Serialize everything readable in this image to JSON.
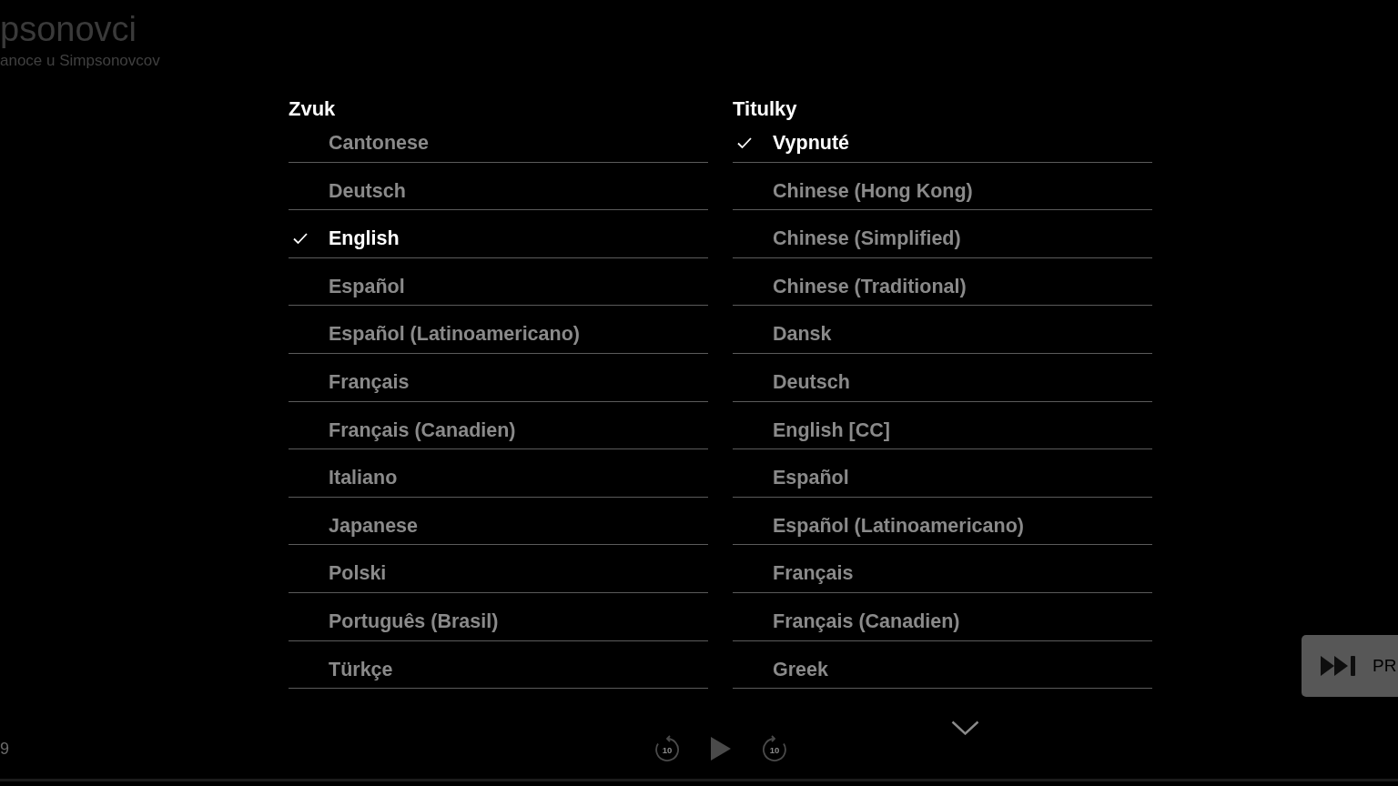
{
  "show": {
    "title": "psonovci",
    "episode": "anoce u Simpsonovcov"
  },
  "audio": {
    "heading": "Zvuk",
    "options": [
      {
        "label": "Cantonese",
        "selected": false
      },
      {
        "label": "Deutsch",
        "selected": false
      },
      {
        "label": "English",
        "selected": true
      },
      {
        "label": "Español",
        "selected": false
      },
      {
        "label": "Español (Latinoamericano)",
        "selected": false
      },
      {
        "label": "Français",
        "selected": false
      },
      {
        "label": "Français (Canadien)",
        "selected": false
      },
      {
        "label": "Italiano",
        "selected": false
      },
      {
        "label": "Japanese",
        "selected": false
      },
      {
        "label": "Polski",
        "selected": false
      },
      {
        "label": "Português (Brasil)",
        "selected": false
      },
      {
        "label": "Türkçe",
        "selected": false
      }
    ]
  },
  "subtitles": {
    "heading": "Titulky",
    "options": [
      {
        "label": "Vypnuté",
        "selected": true
      },
      {
        "label": "Chinese (Hong Kong)",
        "selected": false
      },
      {
        "label": "Chinese (Simplified)",
        "selected": false
      },
      {
        "label": "Chinese (Traditional)",
        "selected": false
      },
      {
        "label": "Dansk",
        "selected": false
      },
      {
        "label": "Deutsch",
        "selected": false
      },
      {
        "label": "English [CC]",
        "selected": false
      },
      {
        "label": "Español",
        "selected": false
      },
      {
        "label": "Español (Latinoamericano)",
        "selected": false
      },
      {
        "label": "Français",
        "selected": false
      },
      {
        "label": "Français (Canadien)",
        "selected": false
      },
      {
        "label": "Greek",
        "selected": false
      }
    ]
  },
  "player": {
    "time": "9",
    "rewind_label": "10",
    "forward_label": "10",
    "skip_label": "PR"
  }
}
